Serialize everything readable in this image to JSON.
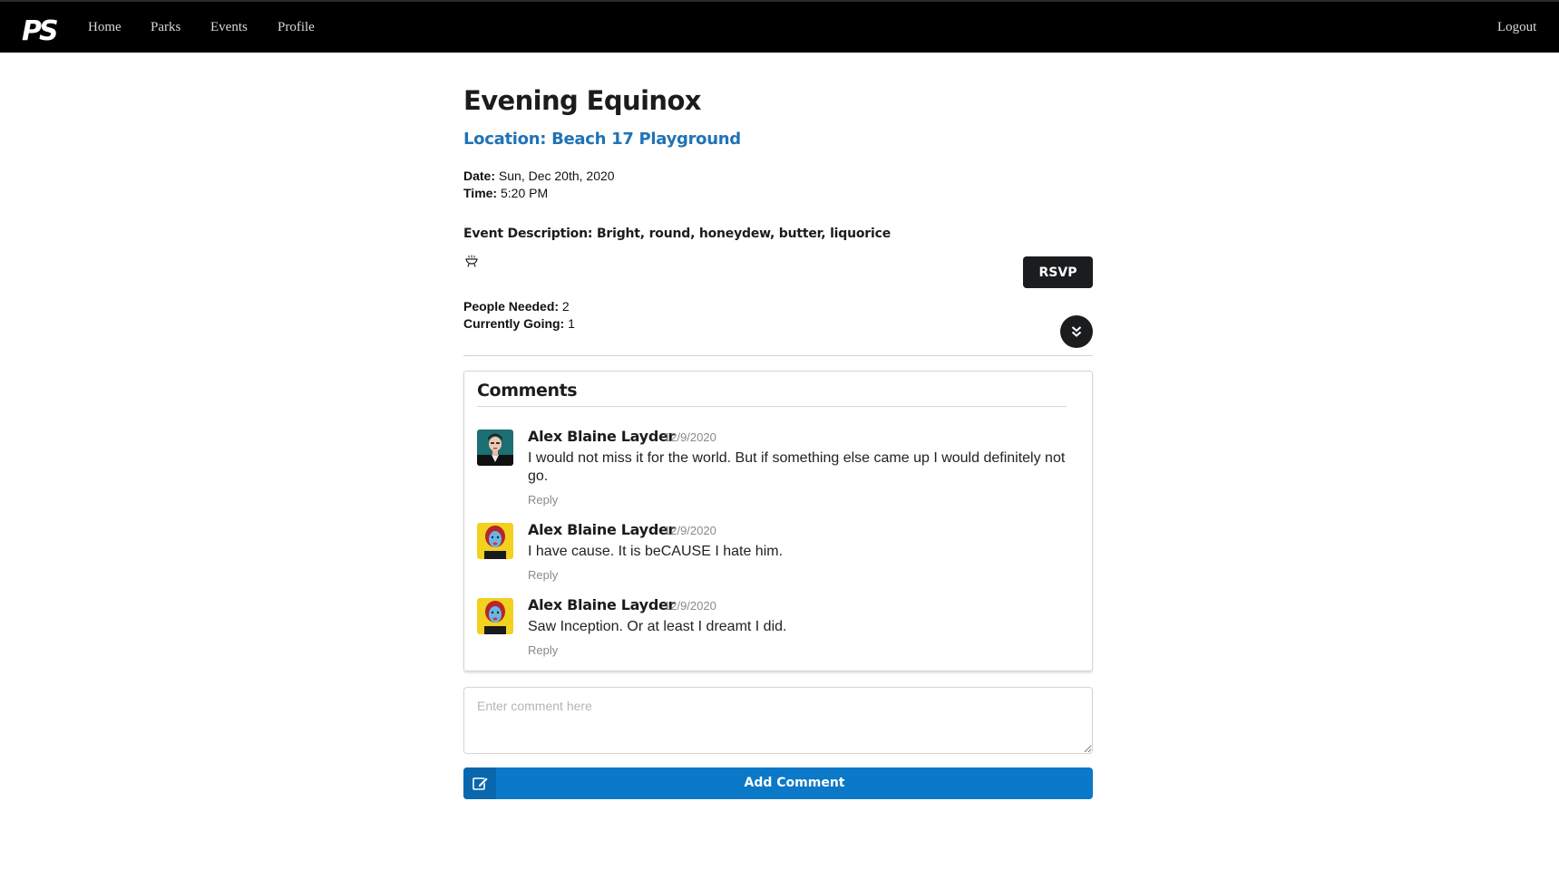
{
  "nav": {
    "logo_text": "PS",
    "items": [
      "Home",
      "Parks",
      "Events",
      "Profile"
    ],
    "logout": "Logout"
  },
  "event": {
    "title": "Evening Equinox",
    "location": "Location: Beach 17 Playground",
    "date_label": "Date:",
    "date_value": "Sun, Dec 20th, 2020",
    "time_label": "Time:",
    "time_value": "5:20 PM",
    "description": "Event Description: Bright, round, honeydew, butter, liquorice",
    "rsvp_label": "RSVP",
    "people_needed_label": "People Needed:",
    "people_needed_value": "2",
    "currently_going_label": "Currently Going:",
    "currently_going_value": "1"
  },
  "comments": {
    "header": "Comments",
    "items": [
      {
        "author": "Alex Blaine Layder",
        "date": "12/9/2020",
        "text": "I would not miss it for the world. But if something else came up I would definitely not go.",
        "reply": "Reply",
        "avatar": "avatar-man-teal"
      },
      {
        "author": "Alex Blaine Layder",
        "date": "12/9/2020",
        "text": "I have cause. It is beCAUSE I hate him.",
        "reply": "Reply",
        "avatar": "avatar-woman-yellow"
      },
      {
        "author": "Alex Blaine Layder",
        "date": "12/9/2020",
        "text": "Saw Inception. Or at least I dreamt I did.",
        "reply": "Reply",
        "avatar": "avatar-woman-yellow"
      }
    ]
  },
  "form": {
    "placeholder": "Enter comment here",
    "value": "",
    "add_label": "Add Comment"
  },
  "colors": {
    "navbar": "#000000",
    "link_blue": "#1f73b7",
    "button_blue": "#0b78c8",
    "dark_button": "#1b1c1d"
  },
  "icons": [
    "ps-logo",
    "grill-icon",
    "chevron-double-down-icon",
    "edit-icon"
  ]
}
